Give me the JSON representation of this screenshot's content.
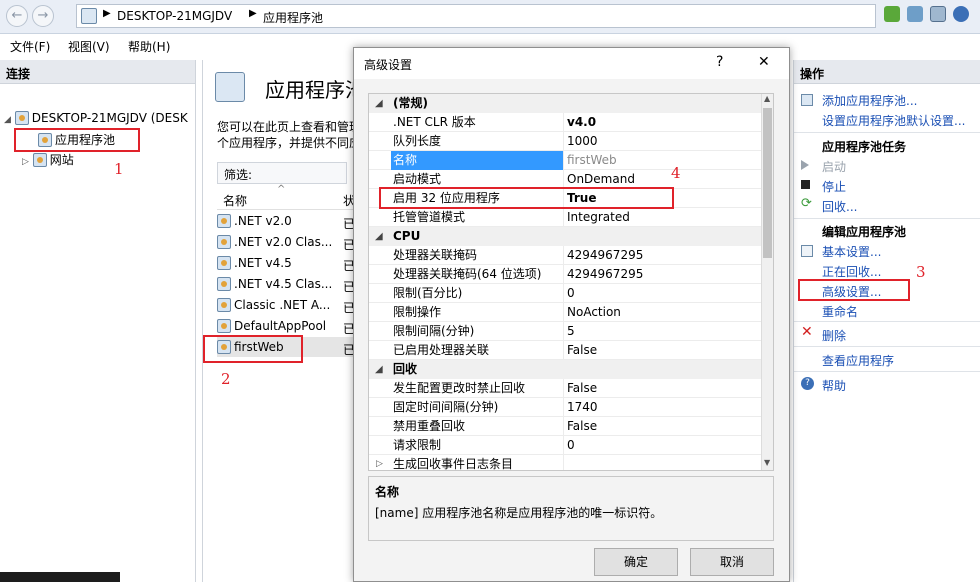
{
  "address": {
    "path": [
      "DESKTOP-21MGJDV",
      "应用程序池"
    ]
  },
  "menu": [
    "文件(F)",
    "视图(V)",
    "帮助(H)"
  ],
  "connections": {
    "header": "连接",
    "server": "DESKTOP-21MGJDV (DESK",
    "app_pools": "应用程序池",
    "sites": "网站"
  },
  "middle": {
    "title": "应用程序池",
    "desc_line1": "您可以在此页上查看和管理",
    "desc_line2": "个应用程序，并提供不同应",
    "filter_label": "筛选:",
    "col_name": "名称",
    "col_status": "状",
    "pools": [
      ".NET v2.0",
      ".NET v2.0 Clas...",
      ".NET v4.5",
      ".NET v4.5 Clas...",
      "Classic .NET A...",
      "DefaultAppPool",
      "firstWeb"
    ],
    "status_short": "已"
  },
  "actions": {
    "header": "操作",
    "add_pool": "添加应用程序池...",
    "set_defaults": "设置应用程序池默认设置...",
    "tasks_header": "应用程序池任务",
    "start": "启动",
    "stop": "停止",
    "recycle": "回收...",
    "edit_header": "编辑应用程序池",
    "basic": "基本设置...",
    "recycling": "正在回收...",
    "advanced": "高级设置...",
    "rename": "重命名",
    "delete": "删除",
    "view_apps": "查看应用程序",
    "help": "帮助"
  },
  "dialog": {
    "title": "高级设置",
    "help_glyph": "?",
    "close_glyph": "✕",
    "categories": {
      "general": "(常规)",
      "cpu": "CPU",
      "recycle": "回收"
    },
    "general_props": [
      {
        "name": ".NET CLR 版本",
        "value": "v4.0"
      },
      {
        "name": "队列长度",
        "value": "1000"
      },
      {
        "name": "名称",
        "value": "firstWeb"
      },
      {
        "name": "启动模式",
        "value": "OnDemand"
      },
      {
        "name": "启用 32 位应用程序",
        "value": "True"
      },
      {
        "name": "托管管道模式",
        "value": "Integrated"
      }
    ],
    "cpu_props": [
      {
        "name": "处理器关联掩码",
        "value": "4294967295"
      },
      {
        "name": "处理器关联掩码(64 位选项)",
        "value": "4294967295"
      },
      {
        "name": "限制(百分比)",
        "value": "0"
      },
      {
        "name": "限制操作",
        "value": "NoAction"
      },
      {
        "name": "限制间隔(分钟)",
        "value": "5"
      },
      {
        "name": "已启用处理器关联",
        "value": "False"
      }
    ],
    "recycle_props": [
      {
        "name": "发生配置更改时禁止回收",
        "value": "False"
      },
      {
        "name": "固定时间间隔(分钟)",
        "value": "1740"
      },
      {
        "name": "禁用重叠回收",
        "value": "False"
      },
      {
        "name": "请求限制",
        "value": "0"
      },
      {
        "name": "生成回收事件日志条目",
        "value": ""
      }
    ],
    "desc_title": "名称",
    "desc_text": "[name] 应用程序池名称是应用程序池的唯一标识符。",
    "ok": "确定",
    "cancel": "取消"
  },
  "annotations": [
    "1",
    "2",
    "3",
    "4"
  ],
  "colors": {
    "annotation_red": "#e0222a",
    "selection_blue": "#3399ff",
    "link_blue": "#1a4fb4"
  }
}
